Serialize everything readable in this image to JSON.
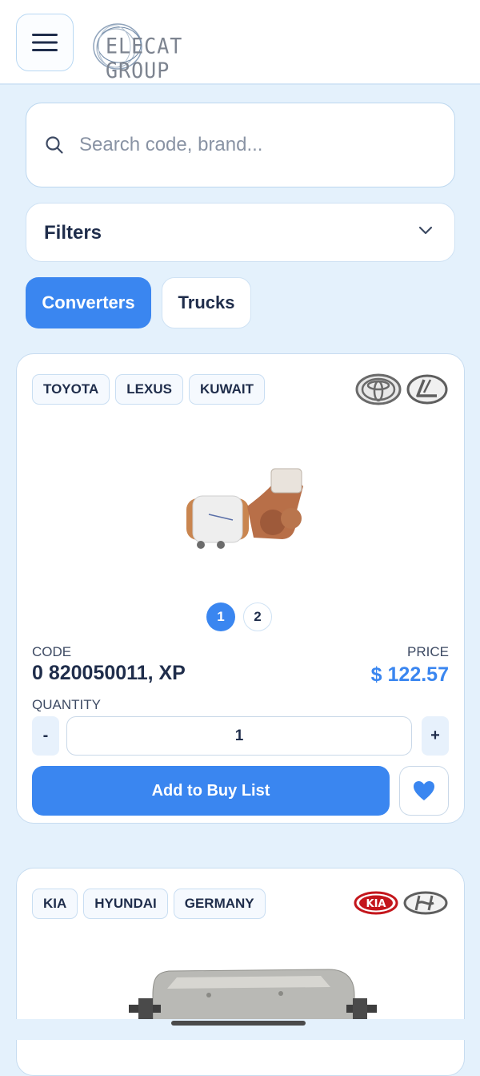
{
  "header": {
    "brand_name": "ELECAT GROUP",
    "menu_icon": "hamburger-menu-icon"
  },
  "search": {
    "placeholder": "Search code, brand...",
    "icon": "search-icon"
  },
  "filters": {
    "label": "Filters",
    "icon": "chevron-down-icon"
  },
  "tabs": [
    {
      "label": "Converters",
      "active": true
    },
    {
      "label": "Trucks",
      "active": false
    }
  ],
  "products": [
    {
      "tags": [
        "TOYOTA",
        "LEXUS",
        "KUWAIT"
      ],
      "brand_logos": [
        "toyota-logo",
        "lexus-logo"
      ],
      "image_pages": [
        "1",
        "2"
      ],
      "active_page": "1",
      "code_label": "CODE",
      "code": "0 820050011, XP",
      "price_label": "PRICE",
      "price": "$ 122.57",
      "quantity_label": "QUANTITY",
      "quantity": "1",
      "minus_label": "-",
      "plus_label": "+",
      "buy_label": "Add to Buy List"
    },
    {
      "tags": [
        "KIA",
        "HYUNDAI",
        "GERMANY"
      ],
      "brand_logos": [
        "kia-logo",
        "hyundai-logo"
      ]
    }
  ],
  "colors": {
    "accent": "#3a86f0",
    "background": "#e4f1fc",
    "text": "#1f2d4b"
  }
}
